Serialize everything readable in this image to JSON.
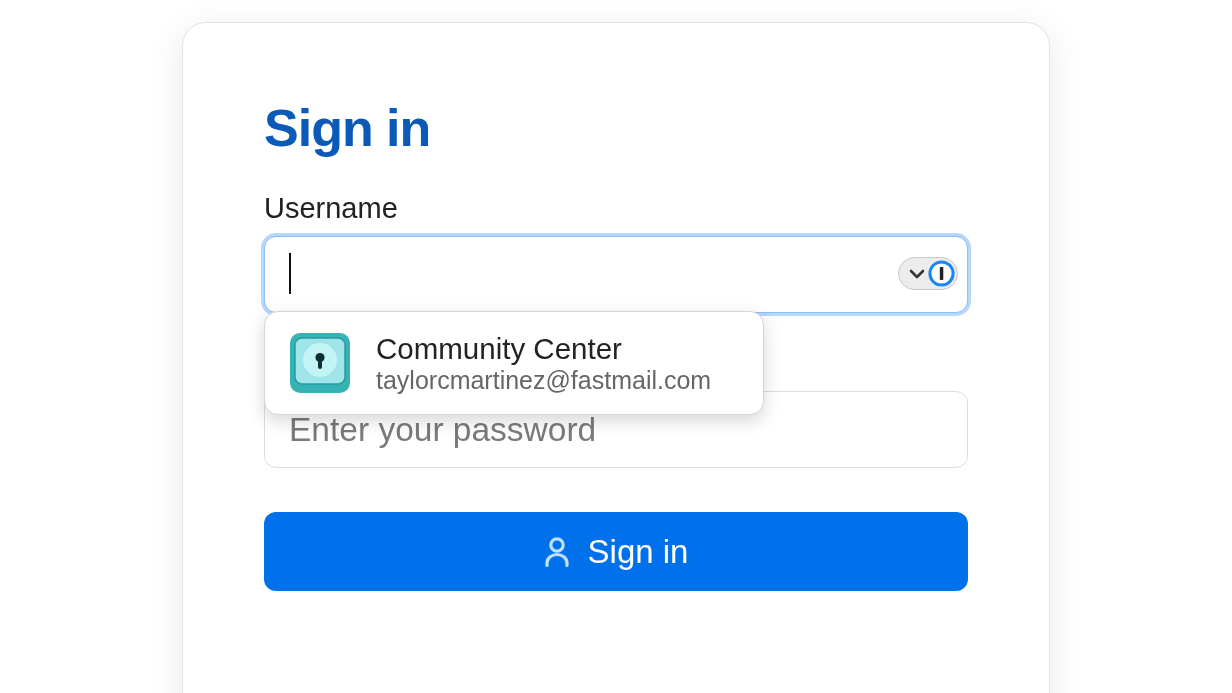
{
  "card": {
    "title": "Sign in"
  },
  "fields": [
    {
      "label": "Username",
      "focused": true,
      "autofill_menu": {
        "items": [
          {
            "title": "Community Center",
            "subtitle": "taylorcmartinez@fastmail.com"
          }
        ]
      }
    },
    {
      "placeholder": "Enter your password",
      "focused": false
    }
  ],
  "submit_button": {
    "label": "Sign in"
  }
}
